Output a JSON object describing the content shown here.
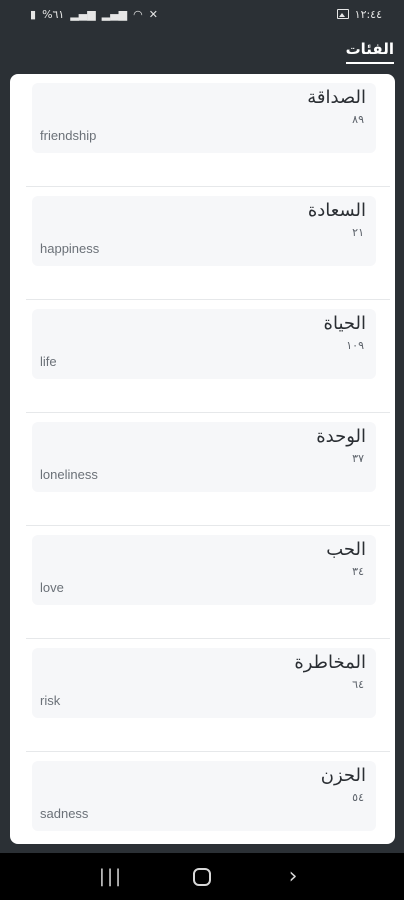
{
  "status_bar": {
    "time": "١٢:٤٤",
    "battery": "%٦١"
  },
  "header": {
    "title": "الفئات"
  },
  "categories": [
    {
      "name_ar": "الصداقة",
      "count": "٨٩",
      "name_en": "friendship"
    },
    {
      "name_ar": "السعادة",
      "count": "٢١",
      "name_en": "happiness"
    },
    {
      "name_ar": "الحياة",
      "count": "١٠٩",
      "name_en": "life"
    },
    {
      "name_ar": "الوحدة",
      "count": "٣٧",
      "name_en": "loneliness"
    },
    {
      "name_ar": "الحب",
      "count": "٣٤",
      "name_en": "love"
    },
    {
      "name_ar": "المخاطرة",
      "count": "٦٤",
      "name_en": "risk"
    },
    {
      "name_ar": "الحزن",
      "count": "٥٤",
      "name_en": "sadness"
    }
  ],
  "nav_bar": {
    "recents_icon": "recents-icon",
    "home_icon": "home-icon",
    "back_icon": "back-icon"
  }
}
